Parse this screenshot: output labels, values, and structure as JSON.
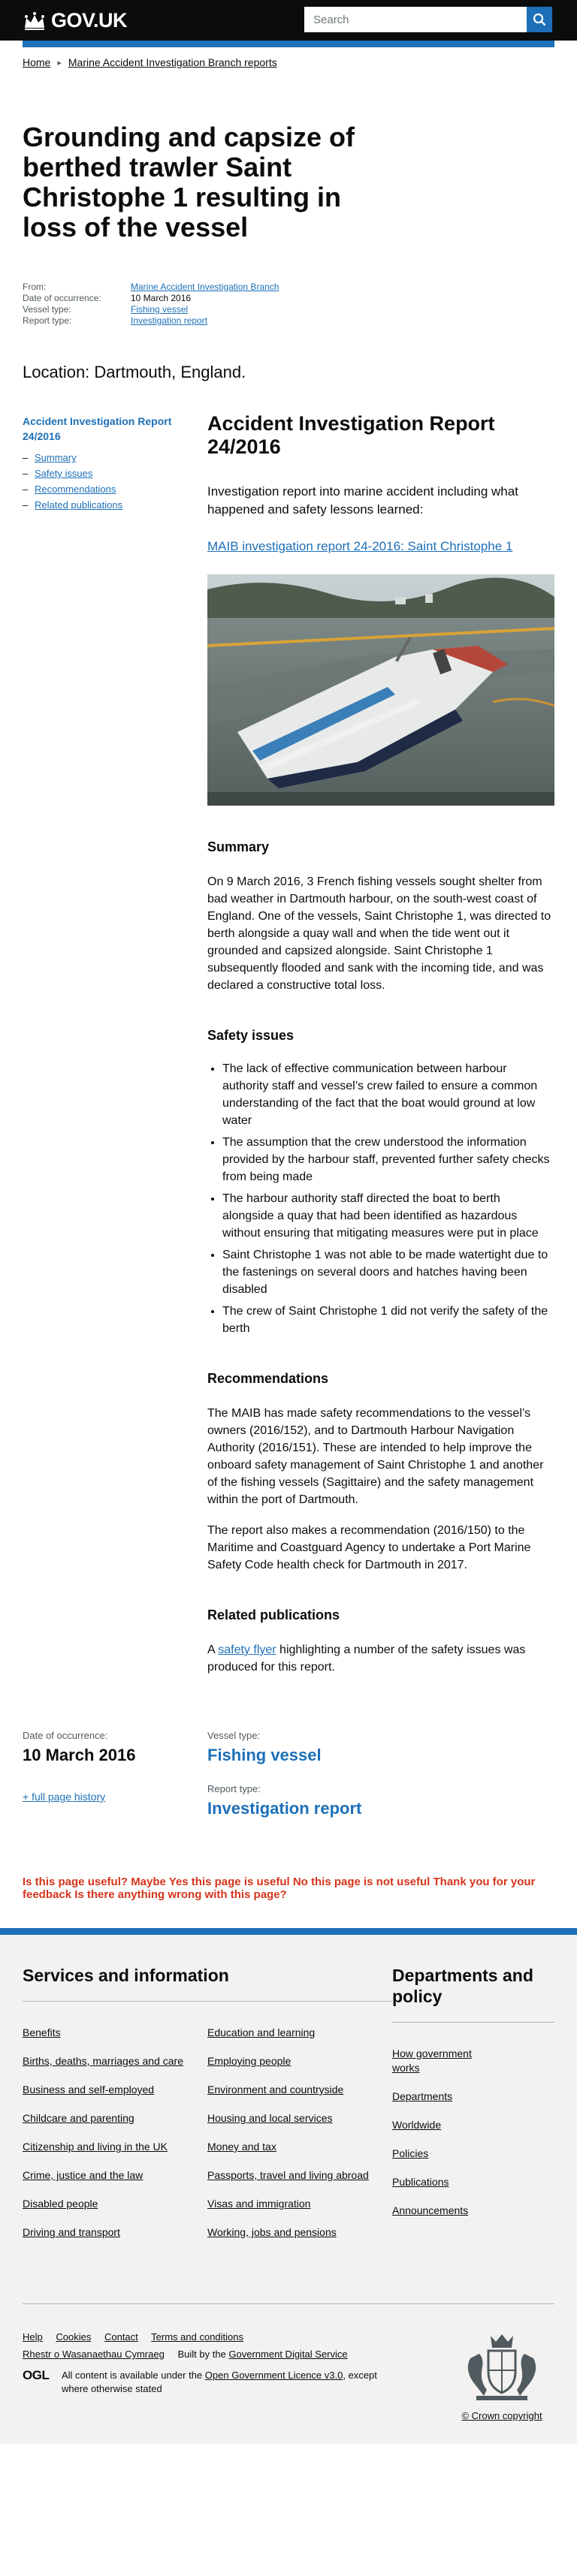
{
  "header": {
    "logo_text": "GOV.UK",
    "search_placeholder": "Search"
  },
  "breadcrumb": [
    "Home",
    "Marine Accident Investigation Branch reports"
  ],
  "title": "Grounding and capsize of berthed trawler Saint Christophe 1 resulting in loss of the vessel",
  "meta": [
    {
      "key": "From:",
      "value": "Marine Accident Investigation Branch",
      "link": true
    },
    {
      "key": "Date of occurrence:",
      "value": "10 March 2016",
      "link": false
    },
    {
      "key": "Vessel type:",
      "value": "Fishing vessel",
      "link": true
    },
    {
      "key": "Report type:",
      "value": "Investigation report",
      "link": true
    }
  ],
  "location": "Location: Dartmouth, England.",
  "contents": {
    "title": "Accident Investigation Report 24/2016",
    "items": [
      "Summary",
      "Safety issues",
      "Recommendations",
      "Related publications"
    ]
  },
  "report": {
    "heading": "Accident Investigation Report 24/2016",
    "lead": "Investigation report into marine accident including what happened and safety lessons learned:",
    "doc_link": "MAIB investigation report 24-2016: Saint Christophe 1"
  },
  "summary": {
    "heading": "Summary",
    "text": "On 9 March 2016, 3 French fishing vessels sought shelter from bad weather in Dartmouth harbour, on the south-west coast of England. One of the vessels, Saint Christophe 1, was directed to berth alongside a quay wall and when the tide went out it grounded and capsized alongside. Saint Christophe 1 subsequently flooded and sank with the incoming tide, and was declared a constructive total loss."
  },
  "safety_issues": {
    "heading": "Safety issues",
    "items": [
      "The lack of effective communication between harbour authority staff and vessel’s crew failed to ensure a common understanding of the fact that the boat would ground at low water",
      "The assumption that the crew understood the information provided by the harbour staff, prevented further safety checks from being made",
      "The harbour authority staff directed the boat to berth alongside a quay that had been identified as hazardous without ensuring that mitigating measures were put in place",
      "Saint Christophe 1 was not able to be made watertight due to the fastenings on several doors and hatches having been disabled",
      "The crew of Saint Christophe 1 did not verify the safety of the berth"
    ]
  },
  "recommendations": {
    "heading": "Recommendations",
    "p1": "The MAIB has made safety recommendations to the vessel’s owners (2016/152), and to Dartmouth Harbour Navigation Authority (2016/151). These are intended to help improve the onboard safety management of Saint Christophe 1 and another of the fishing vessels (Sagittaire) and the safety management within the port of Dartmouth.",
    "p2": "The report also makes a recommendation (2016/150) to the Maritime and Coastguard Agency to undertake a Port Marine Safety Code health check for Dartmouth in 2017."
  },
  "related": {
    "heading": "Related publications",
    "before": "A ",
    "link": "safety flyer",
    "after": " highlighting a number of the safety issues was produced for this report."
  },
  "bottom_meta": {
    "date_label": "Date of occurrence:",
    "date_value": "10 March 2016",
    "history_link": "+ full page history",
    "vessel_label": "Vessel type:",
    "vessel_value": "Fishing vessel",
    "report_label": "Report type:",
    "report_value": "Investigation report"
  },
  "feedback": "Is this page useful? Maybe Yes this page is useful No this page is not useful Thank you for your feedback Is there anything wrong with this page?",
  "footer": {
    "services_heading": "Services and information",
    "services_col1": [
      "Benefits",
      "Births, deaths, marriages and care",
      "Business and self-employed",
      "Childcare and parenting",
      "Citizenship and living in the UK",
      "Crime, justice and the law",
      "Disabled people",
      "Driving and transport"
    ],
    "services_col2": [
      "Education and learning",
      "Employing people",
      "Environment and countryside",
      "Housing and local services",
      "Money and tax",
      "Passports, travel and living abroad",
      "Visas and immigration",
      "Working, jobs and pensions"
    ],
    "dept_heading": "Departments and policy",
    "dept_links": [
      "How government works",
      "Departments",
      "Worldwide",
      "Policies",
      "Publications",
      "Announcements"
    ],
    "bottom_links_row1": [
      "Help",
      "Cookies",
      "Contact",
      "Terms and conditions"
    ],
    "welsh_link": "Rhestr o Wasanaethau Cymraeg",
    "built_by_prefix": "Built by the ",
    "built_by_link": "Government Digital Service",
    "ogl_logo": "OGL",
    "ogl_prefix": "All content is available under the ",
    "ogl_link": "Open Government Licence v3.0",
    "ogl_suffix": ", except where otherwise stated",
    "copyright": "© Crown copyright"
  },
  "colors": {
    "header_bg": "#0b0c0c",
    "link": "#1d70b8",
    "footer_bg": "#f3f2f1",
    "feedback_red": "#d4351c"
  }
}
